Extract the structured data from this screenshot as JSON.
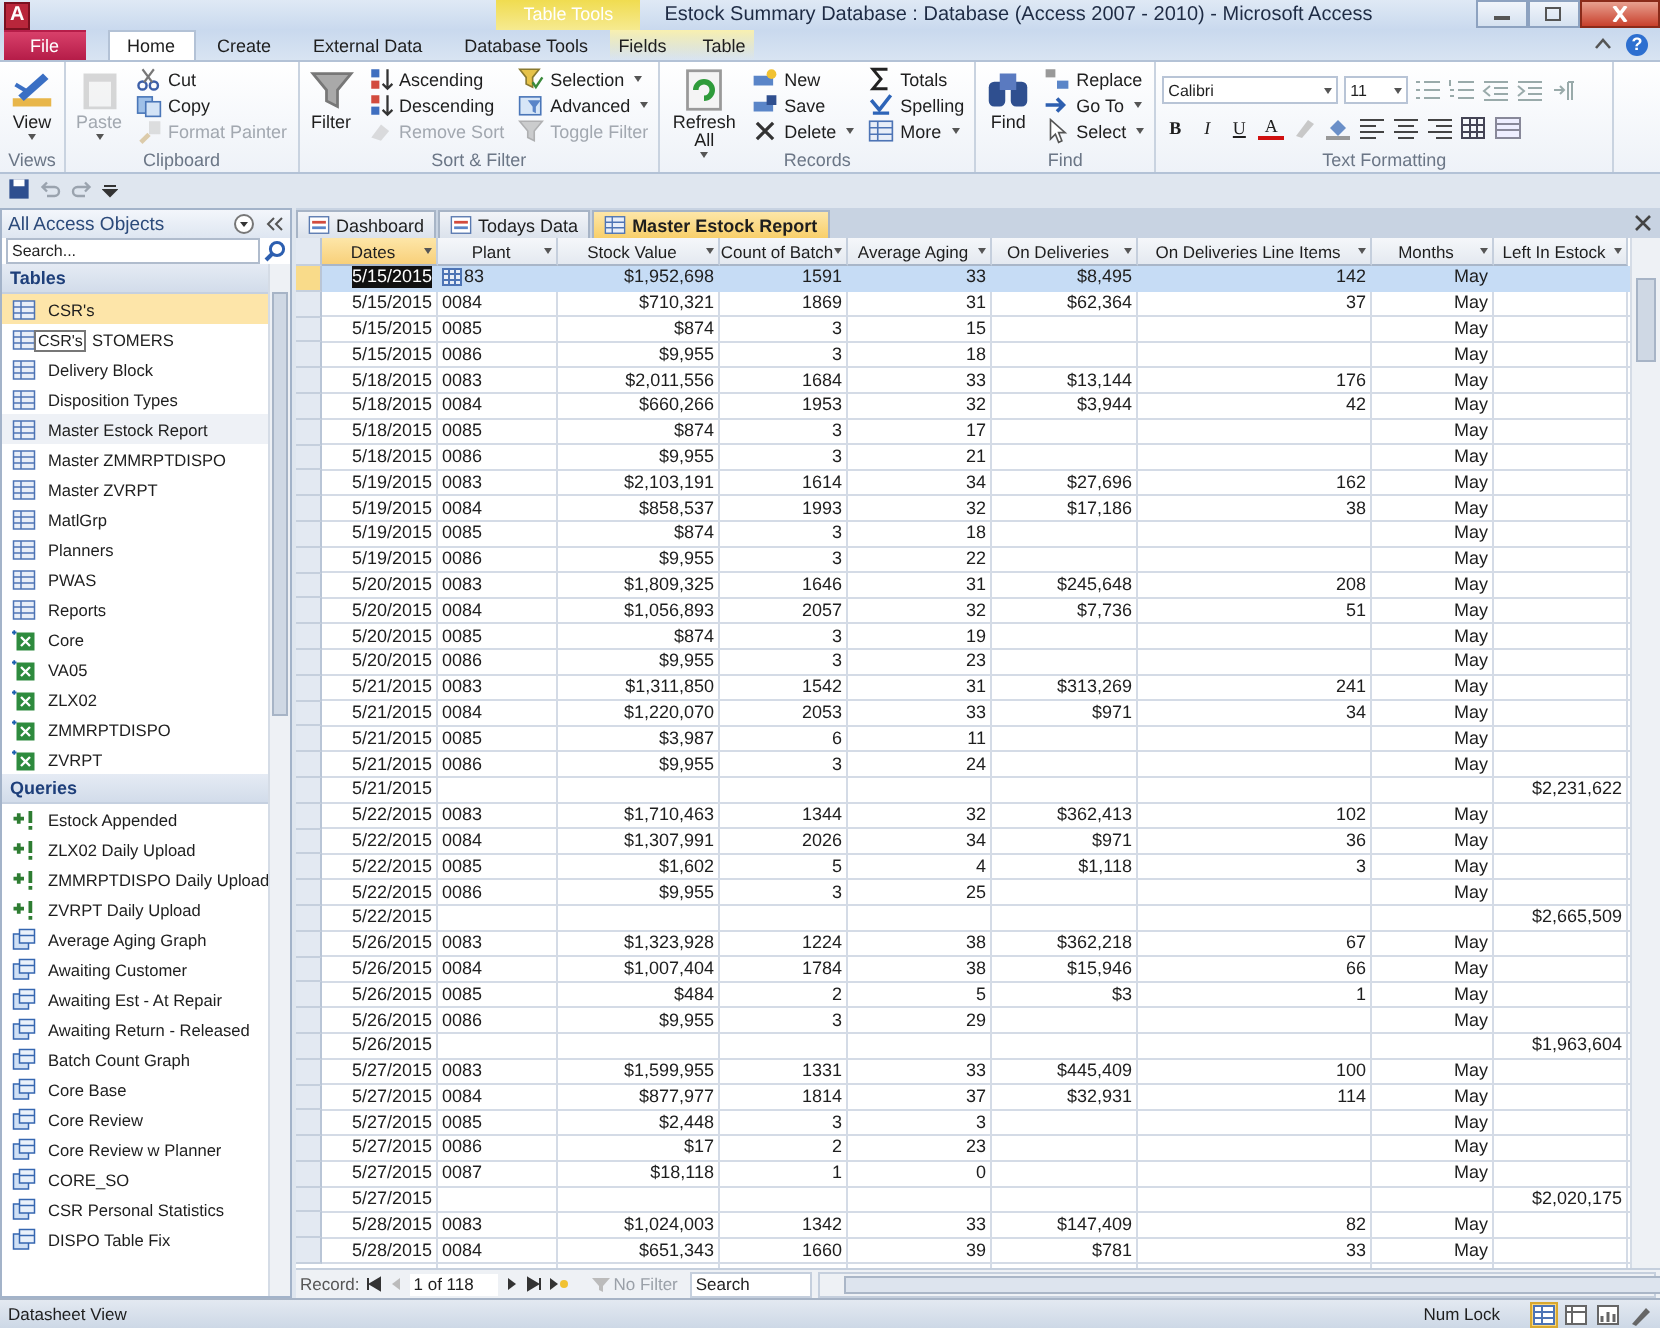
{
  "window": {
    "app_letter": "A",
    "title": "Estock Summary Database : Database (Access 2007 - 2010)  -  Microsoft Access",
    "help": "?"
  },
  "ribbon": {
    "context_label": "Table Tools",
    "tabs": [
      {
        "label": "File",
        "kind": "file",
        "selected": false
      },
      {
        "label": "Home",
        "kind": "normal",
        "selected": true
      },
      {
        "label": "Create",
        "kind": "normal",
        "selected": false
      },
      {
        "label": "External Data",
        "kind": "normal",
        "selected": false
      },
      {
        "label": "Database Tools",
        "kind": "normal",
        "selected": false
      },
      {
        "label": "Fields",
        "kind": "context",
        "selected": false
      },
      {
        "label": "Table",
        "kind": "context",
        "selected": false
      }
    ],
    "groups": [
      {
        "label": "Views",
        "columns": [
          [
            {
              "label": "View",
              "kind": "large",
              "disabled": false,
              "dropdown": true
            }
          ]
        ]
      },
      {
        "label": "Clipboard",
        "columns": [
          [
            {
              "label": "Paste",
              "kind": "large",
              "disabled": true,
              "dropdown": true
            }
          ],
          [
            {
              "label": "Cut",
              "kind": "small",
              "disabled": false,
              "dropdown": false
            },
            {
              "label": "Copy",
              "kind": "small",
              "disabled": false,
              "dropdown": false
            },
            {
              "label": "Format Painter",
              "kind": "small",
              "disabled": true,
              "dropdown": false
            }
          ]
        ]
      },
      {
        "label": "Sort & Filter",
        "columns": [
          [
            {
              "label": "Filter",
              "kind": "large",
              "disabled": false,
              "dropdown": false
            }
          ],
          [
            {
              "label": "Ascending",
              "kind": "small",
              "disabled": false,
              "dropdown": false
            },
            {
              "label": "Descending",
              "kind": "small",
              "disabled": false,
              "dropdown": false
            },
            {
              "label": "Remove Sort",
              "kind": "small",
              "disabled": true,
              "dropdown": false
            }
          ],
          [
            {
              "label": "Selection",
              "kind": "small",
              "disabled": false,
              "dropdown": true
            },
            {
              "label": "Advanced",
              "kind": "small",
              "disabled": false,
              "dropdown": true
            },
            {
              "label": "Toggle Filter",
              "kind": "small",
              "disabled": true,
              "dropdown": false
            }
          ]
        ]
      },
      {
        "label": "Records",
        "columns": [
          [
            {
              "label": "Refresh All",
              "kind": "large",
              "disabled": false,
              "dropdown": true
            }
          ],
          [
            {
              "label": "New",
              "kind": "small",
              "disabled": false,
              "dropdown": false
            },
            {
              "label": "Save",
              "kind": "small",
              "disabled": false,
              "dropdown": false
            },
            {
              "label": "Delete",
              "kind": "small",
              "disabled": false,
              "dropdown": true
            }
          ],
          [
            {
              "label": "Totals",
              "kind": "small",
              "disabled": false,
              "dropdown": false
            },
            {
              "label": "Spelling",
              "kind": "small",
              "disabled": false,
              "dropdown": false
            },
            {
              "label": "More",
              "kind": "small",
              "disabled": false,
              "dropdown": true
            }
          ]
        ]
      },
      {
        "label": "Find",
        "columns": [
          [
            {
              "label": "Find",
              "kind": "large",
              "disabled": false,
              "dropdown": false
            }
          ],
          [
            {
              "label": "Replace",
              "kind": "small",
              "disabled": false,
              "dropdown": false
            },
            {
              "label": "Go To",
              "kind": "small",
              "disabled": false,
              "dropdown": true
            },
            {
              "label": "Select",
              "kind": "small",
              "disabled": false,
              "dropdown": true
            }
          ]
        ]
      }
    ],
    "text_formatting": {
      "label": "Text Formatting",
      "font": "Calibri",
      "size": "11",
      "bold": "B",
      "italic": "I",
      "underline": "U",
      "font_color": "A"
    }
  },
  "doc_tabs": [
    {
      "label": "Dashboard",
      "kind": "form",
      "selected": false
    },
    {
      "label": "Todays Data",
      "kind": "form",
      "selected": false
    },
    {
      "label": "Master Estock Report",
      "kind": "table",
      "selected": true
    }
  ],
  "nav": {
    "title": "All Access Objects",
    "search_placeholder": "Search...",
    "sections": [
      {
        "label": "Tables",
        "items": [
          {
            "label": "CSR's",
            "kind": "table",
            "selected": true,
            "hovered": false
          },
          {
            "label": "STOMERS",
            "kind": "table",
            "selected": false,
            "hovered": false,
            "tooltip": "CSR's"
          },
          {
            "label": "Delivery Block",
            "kind": "table",
            "selected": false,
            "hovered": false
          },
          {
            "label": "Disposition Types",
            "kind": "table",
            "selected": false,
            "hovered": false
          },
          {
            "label": "Master Estock Report",
            "kind": "table",
            "selected": false,
            "hovered": true
          },
          {
            "label": "Master ZMMRPTDISPO",
            "kind": "table",
            "selected": false,
            "hovered": false
          },
          {
            "label": "Master ZVRPT",
            "kind": "table",
            "selected": false,
            "hovered": false
          },
          {
            "label": "MatlGrp",
            "kind": "table",
            "selected": false,
            "hovered": false
          },
          {
            "label": "Planners",
            "kind": "table",
            "selected": false,
            "hovered": false
          },
          {
            "label": "PWAS",
            "kind": "table",
            "selected": false,
            "hovered": false
          },
          {
            "label": "Reports",
            "kind": "table",
            "selected": false,
            "hovered": false
          },
          {
            "label": "Core",
            "kind": "linked",
            "selected": false,
            "hovered": false
          },
          {
            "label": "VA05",
            "kind": "linked",
            "selected": false,
            "hovered": false
          },
          {
            "label": "ZLX02",
            "kind": "linked",
            "selected": false,
            "hovered": false
          },
          {
            "label": "ZMMRPTDISPO",
            "kind": "linked",
            "selected": false,
            "hovered": false
          },
          {
            "label": "ZVRPT",
            "kind": "linked",
            "selected": false,
            "hovered": false
          }
        ]
      },
      {
        "label": "Queries",
        "items": [
          {
            "label": "Estock Appended",
            "kind": "append",
            "selected": false,
            "hovered": false
          },
          {
            "label": "ZLX02 Daily Upload",
            "kind": "append",
            "selected": false,
            "hovered": false
          },
          {
            "label": "ZMMRPTDISPO Daily Upload",
            "kind": "append",
            "selected": false,
            "hovered": false
          },
          {
            "label": "ZVRPT Daily Upload",
            "kind": "append",
            "selected": false,
            "hovered": false
          },
          {
            "label": "Average Aging Graph",
            "kind": "select",
            "selected": false,
            "hovered": false
          },
          {
            "label": "Awaiting Customer",
            "kind": "select",
            "selected": false,
            "hovered": false
          },
          {
            "label": "Awaiting Est - At Repair",
            "kind": "select",
            "selected": false,
            "hovered": false
          },
          {
            "label": "Awaiting Return - Released",
            "kind": "select",
            "selected": false,
            "hovered": false
          },
          {
            "label": "Batch Count Graph",
            "kind": "select",
            "selected": false,
            "hovered": false
          },
          {
            "label": "Core Base",
            "kind": "select",
            "selected": false,
            "hovered": false
          },
          {
            "label": "Core Review",
            "kind": "select",
            "selected": false,
            "hovered": false
          },
          {
            "label": "Core Review w Planner",
            "kind": "select",
            "selected": false,
            "hovered": false
          },
          {
            "label": "CORE_SO",
            "kind": "select",
            "selected": false,
            "hovered": false
          },
          {
            "label": "CSR Personal Statistics",
            "kind": "select",
            "selected": false,
            "hovered": false
          },
          {
            "label": "DISPO Table Fix",
            "kind": "select",
            "selected": false,
            "hovered": false
          }
        ]
      }
    ]
  },
  "table": {
    "columns": [
      {
        "label": "Dates",
        "selected": true
      },
      {
        "label": "Plant",
        "selected": false
      },
      {
        "label": "Stock Value",
        "selected": false
      },
      {
        "label": "Count of Batch",
        "selected": false
      },
      {
        "label": "Average Aging",
        "selected": false
      },
      {
        "label": "On Deliveries",
        "selected": false
      },
      {
        "label": "On Deliveries Line Items",
        "selected": false
      },
      {
        "label": "Months",
        "selected": false
      },
      {
        "label": "Left In Estock",
        "selected": false
      }
    ],
    "rows": [
      {
        "selected": true,
        "date": "5/15/2015",
        "plant": "83",
        "stock_value": "$1,952,698",
        "count_of_batch": "1591",
        "average_aging": "33",
        "on_deliveries": "$8,495",
        "on_deliveries_line_items": "142",
        "months": "May"
      },
      {
        "selected": false,
        "date": "5/15/2015",
        "plant": "0084",
        "stock_value": "$710,321",
        "count_of_batch": "1869",
        "average_aging": "31",
        "on_deliveries": "$62,364",
        "on_deliveries_line_items": "37",
        "months": "May"
      },
      {
        "selected": false,
        "date": "5/15/2015",
        "plant": "0085",
        "stock_value": "$874",
        "count_of_batch": "3",
        "average_aging": "15",
        "months": "May"
      },
      {
        "selected": false,
        "date": "5/15/2015",
        "plant": "0086",
        "stock_value": "$9,955",
        "count_of_batch": "3",
        "average_aging": "18",
        "months": "May"
      },
      {
        "selected": false,
        "date": "5/18/2015",
        "plant": "0083",
        "stock_value": "$2,011,556",
        "count_of_batch": "1684",
        "average_aging": "33",
        "on_deliveries": "$13,144",
        "on_deliveries_line_items": "176",
        "months": "May"
      },
      {
        "selected": false,
        "date": "5/18/2015",
        "plant": "0084",
        "stock_value": "$660,266",
        "count_of_batch": "1953",
        "average_aging": "32",
        "on_deliveries": "$3,944",
        "on_deliveries_line_items": "42",
        "months": "May"
      },
      {
        "selected": false,
        "date": "5/18/2015",
        "plant": "0085",
        "stock_value": "$874",
        "count_of_batch": "3",
        "average_aging": "17",
        "months": "May"
      },
      {
        "selected": false,
        "date": "5/18/2015",
        "plant": "0086",
        "stock_value": "$9,955",
        "count_of_batch": "3",
        "average_aging": "21",
        "months": "May"
      },
      {
        "selected": false,
        "date": "5/19/2015",
        "plant": "0083",
        "stock_value": "$2,103,191",
        "count_of_batch": "1614",
        "average_aging": "34",
        "on_deliveries": "$27,696",
        "on_deliveries_line_items": "162",
        "months": "May"
      },
      {
        "selected": false,
        "date": "5/19/2015",
        "plant": "0084",
        "stock_value": "$858,537",
        "count_of_batch": "1993",
        "average_aging": "32",
        "on_deliveries": "$17,186",
        "on_deliveries_line_items": "38",
        "months": "May"
      },
      {
        "selected": false,
        "date": "5/19/2015",
        "plant": "0085",
        "stock_value": "$874",
        "count_of_batch": "3",
        "average_aging": "18",
        "months": "May"
      },
      {
        "selected": false,
        "date": "5/19/2015",
        "plant": "0086",
        "stock_value": "$9,955",
        "count_of_batch": "3",
        "average_aging": "22",
        "months": "May"
      },
      {
        "selected": false,
        "date": "5/20/2015",
        "plant": "0083",
        "stock_value": "$1,809,325",
        "count_of_batch": "1646",
        "average_aging": "31",
        "on_deliveries": "$245,648",
        "on_deliveries_line_items": "208",
        "months": "May"
      },
      {
        "selected": false,
        "date": "5/20/2015",
        "plant": "0084",
        "stock_value": "$1,056,893",
        "count_of_batch": "2057",
        "average_aging": "32",
        "on_deliveries": "$7,736",
        "on_deliveries_line_items": "51",
        "months": "May"
      },
      {
        "selected": false,
        "date": "5/20/2015",
        "plant": "0085",
        "stock_value": "$874",
        "count_of_batch": "3",
        "average_aging": "19",
        "months": "May"
      },
      {
        "selected": false,
        "date": "5/20/2015",
        "plant": "0086",
        "stock_value": "$9,955",
        "count_of_batch": "3",
        "average_aging": "23",
        "months": "May"
      },
      {
        "selected": false,
        "date": "5/21/2015",
        "plant": "0083",
        "stock_value": "$1,311,850",
        "count_of_batch": "1542",
        "average_aging": "31",
        "on_deliveries": "$313,269",
        "on_deliveries_line_items": "241",
        "months": "May"
      },
      {
        "selected": false,
        "date": "5/21/2015",
        "plant": "0084",
        "stock_value": "$1,220,070",
        "count_of_batch": "2053",
        "average_aging": "33",
        "on_deliveries": "$971",
        "on_deliveries_line_items": "34",
        "months": "May"
      },
      {
        "selected": false,
        "date": "5/21/2015",
        "plant": "0085",
        "stock_value": "$3,987",
        "count_of_batch": "6",
        "average_aging": "11",
        "months": "May"
      },
      {
        "selected": false,
        "date": "5/21/2015",
        "plant": "0086",
        "stock_value": "$9,955",
        "count_of_batch": "3",
        "average_aging": "24",
        "months": "May"
      },
      {
        "selected": false,
        "date": "5/21/2015",
        "left_in_estock": "$2,231,622"
      },
      {
        "selected": false,
        "date": "5/22/2015",
        "plant": "0083",
        "stock_value": "$1,710,463",
        "count_of_batch": "1344",
        "average_aging": "32",
        "on_deliveries": "$362,413",
        "on_deliveries_line_items": "102",
        "months": "May"
      },
      {
        "selected": false,
        "date": "5/22/2015",
        "plant": "0084",
        "stock_value": "$1,307,991",
        "count_of_batch": "2026",
        "average_aging": "34",
        "on_deliveries": "$971",
        "on_deliveries_line_items": "36",
        "months": "May"
      },
      {
        "selected": false,
        "date": "5/22/2015",
        "plant": "0085",
        "stock_value": "$1,602",
        "count_of_batch": "5",
        "average_aging": "4",
        "on_deliveries": "$1,118",
        "on_deliveries_line_items": "3",
        "months": "May"
      },
      {
        "selected": false,
        "date": "5/22/2015",
        "plant": "0086",
        "stock_value": "$9,955",
        "count_of_batch": "3",
        "average_aging": "25",
        "months": "May"
      },
      {
        "selected": false,
        "date": "5/22/2015",
        "left_in_estock": "$2,665,509"
      },
      {
        "selected": false,
        "date": "5/26/2015",
        "plant": "0083",
        "stock_value": "$1,323,928",
        "count_of_batch": "1224",
        "average_aging": "38",
        "on_deliveries": "$362,218",
        "on_deliveries_line_items": "67",
        "months": "May"
      },
      {
        "selected": false,
        "date": "5/26/2015",
        "plant": "0084",
        "stock_value": "$1,007,404",
        "count_of_batch": "1784",
        "average_aging": "38",
        "on_deliveries": "$15,946",
        "on_deliveries_line_items": "66",
        "months": "May"
      },
      {
        "selected": false,
        "date": "5/26/2015",
        "plant": "0085",
        "stock_value": "$484",
        "count_of_batch": "2",
        "average_aging": "5",
        "on_deliveries": "$3",
        "on_deliveries_line_items": "1",
        "months": "May"
      },
      {
        "selected": false,
        "date": "5/26/2015",
        "plant": "0086",
        "stock_value": "$9,955",
        "count_of_batch": "3",
        "average_aging": "29",
        "months": "May"
      },
      {
        "selected": false,
        "date": "5/26/2015",
        "left_in_estock": "$1,963,604"
      },
      {
        "selected": false,
        "date": "5/27/2015",
        "plant": "0083",
        "stock_value": "$1,599,955",
        "count_of_batch": "1331",
        "average_aging": "33",
        "on_deliveries": "$445,409",
        "on_deliveries_line_items": "100",
        "months": "May"
      },
      {
        "selected": false,
        "date": "5/27/2015",
        "plant": "0084",
        "stock_value": "$877,977",
        "count_of_batch": "1814",
        "average_aging": "37",
        "on_deliveries": "$32,931",
        "on_deliveries_line_items": "114",
        "months": "May"
      },
      {
        "selected": false,
        "date": "5/27/2015",
        "plant": "0085",
        "stock_value": "$2,448",
        "count_of_batch": "3",
        "average_aging": "3",
        "months": "May"
      },
      {
        "selected": false,
        "date": "5/27/2015",
        "plant": "0086",
        "stock_value": "$17",
        "count_of_batch": "2",
        "average_aging": "23",
        "months": "May"
      },
      {
        "selected": false,
        "date": "5/27/2015",
        "plant": "0087",
        "stock_value": "$18,118",
        "count_of_batch": "1",
        "average_aging": "0",
        "months": "May"
      },
      {
        "selected": false,
        "date": "5/27/2015",
        "left_in_estock": "$2,020,175"
      },
      {
        "selected": false,
        "date": "5/28/2015",
        "plant": "0083",
        "stock_value": "$1,024,003",
        "count_of_batch": "1342",
        "average_aging": "33",
        "on_deliveries": "$147,409",
        "on_deliveries_line_items": "82",
        "months": "May"
      },
      {
        "selected": false,
        "date": "5/28/2015",
        "plant": "0084",
        "stock_value": "$651,343",
        "count_of_batch": "1660",
        "average_aging": "39",
        "on_deliveries": "$781",
        "on_deliveries_line_items": "33",
        "months": "May"
      }
    ]
  },
  "record_nav": {
    "label": "Record:",
    "position": "1 of 118",
    "filter": "No Filter",
    "search_placeholder": "Search"
  },
  "status_bar": {
    "left": "Datasheet View",
    "right": "Num Lock"
  }
}
